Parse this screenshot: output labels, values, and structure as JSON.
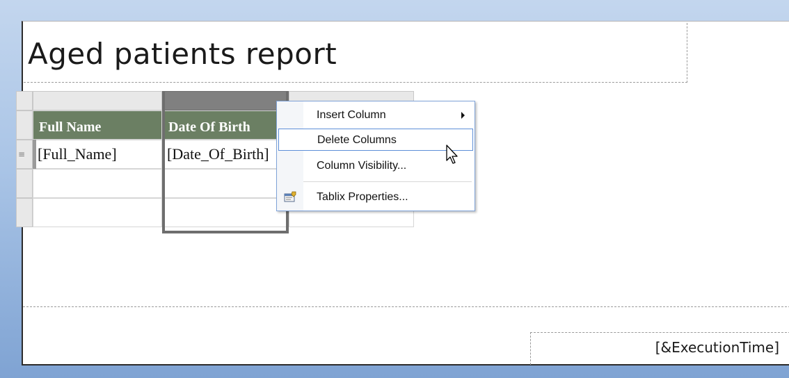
{
  "report": {
    "title": "Aged patients report",
    "footer_field": "[&ExecutionTime]"
  },
  "tablix": {
    "headers": [
      "Full Name",
      "Date Of Birth",
      ""
    ],
    "fields": [
      "[Full_Name]",
      "[Date_Of_Birth]",
      ""
    ],
    "row_handle_icon": "≡"
  },
  "context_menu": {
    "items": [
      {
        "label": "Insert Column",
        "has_submenu": true
      },
      {
        "label": "Delete Columns",
        "highlighted": true
      },
      {
        "label": "Column Visibility..."
      },
      {
        "label": "Tablix Properties...",
        "icon": "properties-icon"
      }
    ]
  },
  "colors": {
    "header_bg": "#6b7f63",
    "selection_border": "#6e6e6e",
    "menu_highlight_border": "#5d8fd8"
  }
}
